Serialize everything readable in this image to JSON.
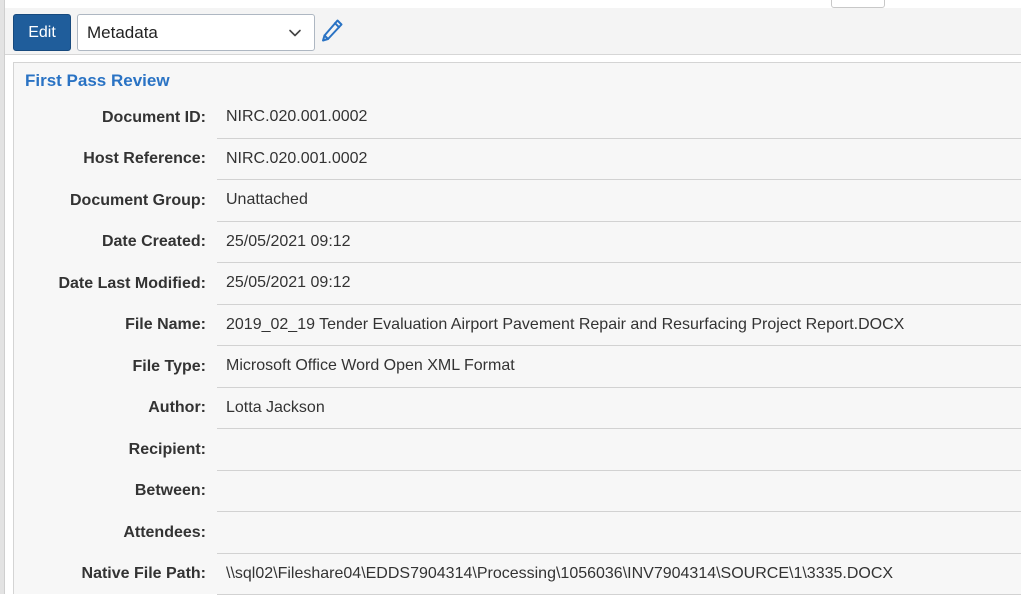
{
  "toolbar": {
    "edit_label": "Edit",
    "view_select_value": "Metadata",
    "edit_icon": "pencil-icon",
    "dropdown_icon": "chevron-down-icon"
  },
  "panel": {
    "title": "First Pass Review",
    "fields": [
      {
        "label": "Document ID:",
        "value": "NIRC.020.001.0002"
      },
      {
        "label": "Host Reference:",
        "value": "NIRC.020.001.0002"
      },
      {
        "label": "Document Group:",
        "value": "Unattached"
      },
      {
        "label": "Date Created:",
        "value": "25/05/2021 09:12"
      },
      {
        "label": "Date Last Modified:",
        "value": "25/05/2021 09:12"
      },
      {
        "label": "File Name:",
        "value": "2019_02_19 Tender Evaluation Airport Pavement Repair and Resurfacing Project Report.DOCX"
      },
      {
        "label": "File Type:",
        "value": "Microsoft Office Word Open XML Format"
      },
      {
        "label": "Author:",
        "value": "Lotta Jackson"
      },
      {
        "label": "Recipient:",
        "value": ""
      },
      {
        "label": "Between:",
        "value": ""
      },
      {
        "label": "Attendees:",
        "value": ""
      },
      {
        "label": "Native File Path:",
        "value": "\\\\sql02\\Fileshare04\\EDDS7904314\\Processing\\1056036\\INV7904314\\SOURCE\\1\\3335.DOCX"
      }
    ]
  },
  "colors": {
    "edit_button_bg": "#1f5d9b",
    "section_title": "#2a73c4",
    "pencil_icon": "#2a73c4"
  }
}
